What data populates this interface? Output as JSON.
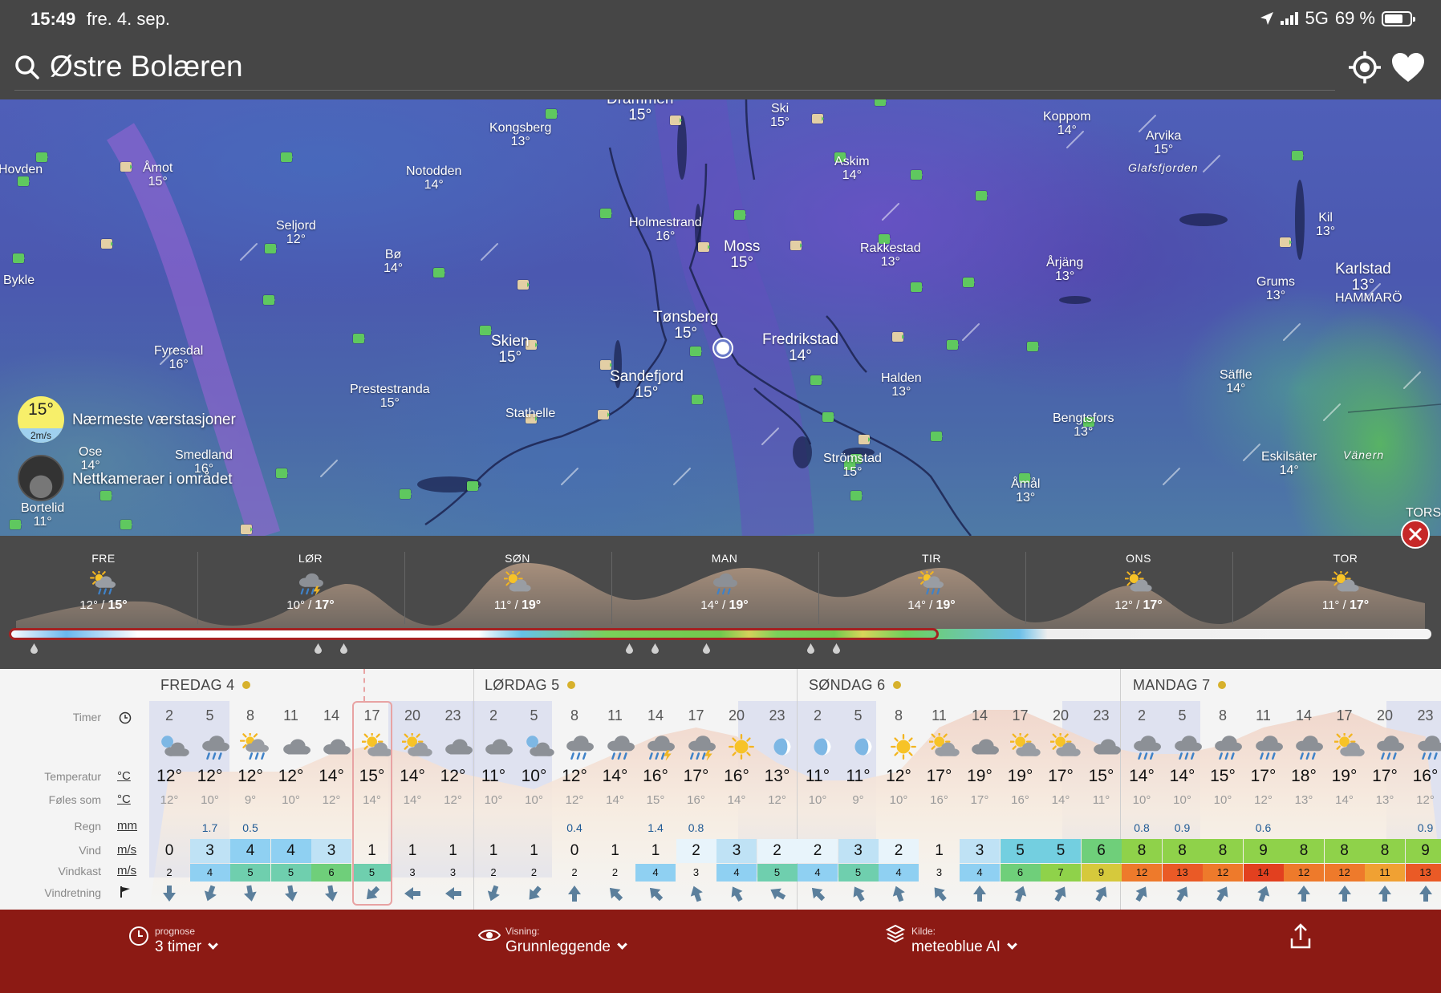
{
  "status": {
    "time": "15:49",
    "date": "fre. 4. sep.",
    "network": "5G",
    "battery": "69 %"
  },
  "search": {
    "location": "Østre Bolæren"
  },
  "map": {
    "cities": [
      {
        "name": "Drammen",
        "temp": "15°",
        "style": "big"
      },
      {
        "name": "Ski",
        "temp": "15°"
      },
      {
        "name": "Kongsberg",
        "temp": "13°"
      },
      {
        "name": "Koppom",
        "temp": "14°"
      },
      {
        "name": "Arvika",
        "temp": "15°"
      },
      {
        "name": "Åmot",
        "temp": "15°"
      },
      {
        "name": "Notodden",
        "temp": "14°"
      },
      {
        "name": "Askim",
        "temp": "14°"
      },
      {
        "name": "Glafsfjorden",
        "temp": "",
        "style": "italic"
      },
      {
        "name": "Hovden",
        "temp": ""
      },
      {
        "name": "Seljord",
        "temp": "12°"
      },
      {
        "name": "Holmestrand",
        "temp": "16°"
      },
      {
        "name": "Kil",
        "temp": "13°"
      },
      {
        "name": "Moss",
        "temp": "15°",
        "style": "big"
      },
      {
        "name": "Rakkestad",
        "temp": "13°"
      },
      {
        "name": "Bø",
        "temp": "14°"
      },
      {
        "name": "Årjäng",
        "temp": "13°"
      },
      {
        "name": "Karlstad",
        "temp": "13°",
        "style": "big"
      },
      {
        "name": "Bykle",
        "temp": ""
      },
      {
        "name": "Grums",
        "temp": "13°"
      },
      {
        "name": "HAMMARÖ",
        "temp": ""
      },
      {
        "name": "Tønsberg",
        "temp": "15°",
        "style": "big"
      },
      {
        "name": "Skien",
        "temp": "15°",
        "style": "big"
      },
      {
        "name": "Fredrikstad",
        "temp": "14°",
        "style": "big"
      },
      {
        "name": "Fyresdal",
        "temp": "16°"
      },
      {
        "name": "Sandefjord",
        "temp": "15°",
        "style": "big"
      },
      {
        "name": "Halden",
        "temp": "13°"
      },
      {
        "name": "Säffle",
        "temp": "14°"
      },
      {
        "name": "Prestestranda",
        "temp": "15°"
      },
      {
        "name": "Stathelle",
        "temp": ""
      },
      {
        "name": "Bengtsfors",
        "temp": "13°"
      },
      {
        "name": "Ose",
        "temp": "14°"
      },
      {
        "name": "Smedland",
        "temp": "16°"
      },
      {
        "name": "Strömstad",
        "temp": "15°"
      },
      {
        "name": "Åmål",
        "temp": "13°"
      },
      {
        "name": "Eskilsäter",
        "temp": "14°"
      },
      {
        "name": "Vänern",
        "temp": "",
        "style": "italic"
      },
      {
        "name": "Bortelid",
        "temp": "11°"
      },
      {
        "name": "TORS",
        "temp": ""
      }
    ],
    "station": {
      "temp": "15°",
      "wind": "2m/s",
      "label": "Nærmeste værstasjoner"
    },
    "webcam": {
      "label": "Nettkameraer i området"
    }
  },
  "week": [
    {
      "day": "FRE",
      "low": "12°",
      "high": "15°",
      "icon": "sun-cloud-rain-icon"
    },
    {
      "day": "LØR",
      "low": "10°",
      "high": "17°",
      "icon": "cloud-rain-thunder-icon"
    },
    {
      "day": "SØN",
      "low": "11°",
      "high": "19°",
      "icon": "sun-cloud-icon"
    },
    {
      "day": "MAN",
      "low": "14°",
      "high": "19°",
      "icon": "cloud-rain-icon"
    },
    {
      "day": "TIR",
      "low": "14°",
      "high": "19°",
      "icon": "sun-cloud-rain-icon"
    },
    {
      "day": "ONS",
      "low": "12°",
      "high": "17°",
      "icon": "sun-cloud-icon"
    },
    {
      "day": "TOR",
      "low": "11°",
      "high": "17°",
      "icon": "sun-cloud-icon"
    }
  ],
  "hourly": {
    "labels": {
      "hours": "Timer",
      "temp": "Temperatur",
      "feels": "Føles som",
      "rain": "Regn",
      "wind": "Vind",
      "gust": "Vindkast",
      "direction": "Vindretning",
      "temp_unit": "°C",
      "feels_unit": "°C",
      "rain_unit": "mm",
      "wind_unit": "m/s",
      "gust_unit": "m/s"
    },
    "days": [
      "FREDAG 4",
      "LØRDAG 5",
      "SØNDAG 6",
      "MANDAG 7"
    ],
    "hours": [
      "2",
      "5",
      "8",
      "11",
      "14",
      "17",
      "20",
      "23",
      "2",
      "5",
      "8",
      "11",
      "14",
      "17",
      "20",
      "23",
      "2",
      "5",
      "8",
      "11",
      "14",
      "17",
      "20",
      "23",
      "2",
      "5",
      "8",
      "11",
      "14",
      "17",
      "20",
      "23"
    ],
    "icons": [
      "moon-cloud-icon",
      "cloud-rain-icon",
      "sun-cloud-rain-icon",
      "cloud-icon",
      "cloud-icon",
      "sun-cloud-icon",
      "sun-cloud-icon",
      "cloud-icon",
      "cloud-icon",
      "moon-cloud-icon",
      "cloud-rain-icon",
      "cloud-rain-icon",
      "cloud-rain-thunder-icon",
      "cloud-rain-thunder-icon",
      "sun-icon",
      "moon-icon",
      "moon-icon",
      "moon-icon",
      "sun-icon",
      "sun-cloud-icon",
      "cloud-icon",
      "sun-cloud-icon",
      "sun-cloud-icon",
      "cloud-icon",
      "cloud-rain-icon",
      "cloud-rain-icon",
      "cloud-rain-icon",
      "cloud-rain-icon",
      "cloud-rain-icon",
      "sun-cloud-icon",
      "cloud-rain-icon",
      "cloud-rain-icon"
    ],
    "temp": [
      "12°",
      "12°",
      "12°",
      "12°",
      "14°",
      "15°",
      "14°",
      "12°",
      "11°",
      "10°",
      "12°",
      "14°",
      "16°",
      "17°",
      "16°",
      "13°",
      "11°",
      "11°",
      "12°",
      "17°",
      "19°",
      "19°",
      "17°",
      "15°",
      "14°",
      "14°",
      "15°",
      "17°",
      "18°",
      "19°",
      "17°",
      "16°"
    ],
    "temp_values": [
      12,
      12,
      12,
      12,
      14,
      15,
      14,
      12,
      11,
      10,
      12,
      14,
      16,
      17,
      16,
      13,
      11,
      11,
      12,
      17,
      19,
      19,
      17,
      15,
      14,
      14,
      15,
      17,
      18,
      19,
      17,
      16
    ],
    "feels": [
      "12°",
      "10°",
      "9°",
      "10°",
      "12°",
      "14°",
      "14°",
      "12°",
      "10°",
      "10°",
      "12°",
      "14°",
      "15°",
      "16°",
      "14°",
      "12°",
      "10°",
      "9°",
      "10°",
      "16°",
      "17°",
      "16°",
      "14°",
      "11°",
      "10°",
      "10°",
      "10°",
      "12°",
      "13°",
      "14°",
      "13°",
      "12°"
    ],
    "rain": [
      "",
      "1.7",
      "0.5",
      "",
      "",
      "",
      "",
      "",
      "",
      "",
      "0.4",
      "",
      "1.4",
      "0.8",
      "",
      "",
      "",
      "",
      "",
      "",
      "",
      "",
      "",
      "",
      "0.8",
      "0.9",
      "",
      "0.6",
      "",
      "",
      "",
      "0.9"
    ],
    "wind": [
      "0",
      "3",
      "4",
      "4",
      "3",
      "1",
      "1",
      "1",
      "1",
      "1",
      "0",
      "1",
      "1",
      "2",
      "3",
      "2",
      "2",
      "3",
      "2",
      "1",
      "3",
      "5",
      "5",
      "6",
      "8",
      "8",
      "8",
      "9",
      "8",
      "8",
      "8",
      "9"
    ],
    "wind_values": [
      0,
      3,
      4,
      4,
      3,
      1,
      1,
      1,
      1,
      1,
      0,
      1,
      1,
      2,
      3,
      2,
      2,
      3,
      2,
      1,
      3,
      5,
      5,
      6,
      8,
      8,
      8,
      9,
      8,
      8,
      8,
      9
    ],
    "gust": [
      "2",
      "4",
      "5",
      "5",
      "6",
      "5",
      "3",
      "3",
      "2",
      "2",
      "2",
      "2",
      "4",
      "3",
      "4",
      "5",
      "4",
      "5",
      "4",
      "3",
      "4",
      "6",
      "7",
      "9",
      "12",
      "13",
      "12",
      "14",
      "12",
      "12",
      "11",
      "13"
    ],
    "gust_values": [
      2,
      4,
      5,
      5,
      6,
      5,
      3,
      3,
      2,
      2,
      2,
      2,
      4,
      3,
      4,
      5,
      4,
      5,
      4,
      3,
      4,
      6,
      7,
      9,
      12,
      13,
      12,
      14,
      12,
      12,
      11,
      13
    ],
    "direction_deg": [
      180,
      200,
      170,
      170,
      170,
      225,
      270,
      270,
      200,
      220,
      0,
      315,
      315,
      340,
      330,
      300,
      315,
      330,
      340,
      320,
      0,
      20,
      30,
      30,
      30,
      30,
      30,
      20,
      0,
      0,
      0,
      0
    ],
    "now_index": 5
  },
  "bottom": {
    "forecast_label": "prognose",
    "forecast_value": "3 timer",
    "view_label": "Visning:",
    "view_value": "Grunnleggende",
    "source_label": "Kilde:",
    "source_value": "meteoblue AI"
  },
  "colors": {
    "accent": "#8c1a14",
    "header": "#464646",
    "station": "#f7ef6a"
  }
}
